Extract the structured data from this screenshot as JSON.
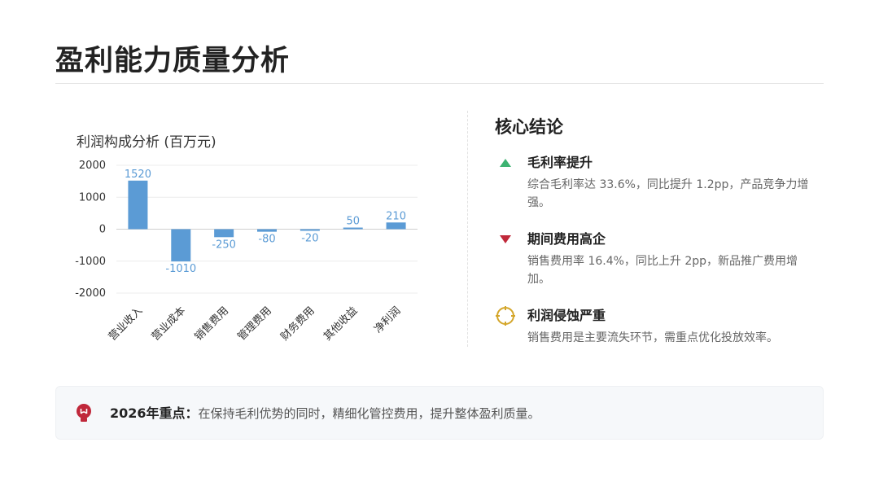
{
  "page": {
    "title": "盈利能力质量分析"
  },
  "chart_data": {
    "type": "bar",
    "title": "利润构成分析 (百万元)",
    "categories": [
      "营业收入",
      "营业成本",
      "销售费用",
      "管理费用",
      "财务费用",
      "其他收益",
      "净利润"
    ],
    "values": [
      1520,
      -1010,
      -250,
      -80,
      -20,
      50,
      210
    ],
    "value_labels": [
      "1520",
      "-1010",
      "-250",
      "-80",
      "-20",
      "50",
      "210"
    ],
    "ylim": [
      -2000,
      2000
    ],
    "yticks": [
      2000,
      1000,
      0,
      -1000,
      -2000
    ],
    "ytick_labels": [
      "2000",
      "1000",
      "0",
      "-1000",
      "-2000"
    ],
    "grid": true,
    "bar_color": "#5b9bd5",
    "label_color": "#5b9bd5"
  },
  "conclusions": {
    "title": "核心结论",
    "items": [
      {
        "icon": "triangle-up-icon",
        "icon_color": "#3cb371",
        "title": "毛利率提升",
        "desc": "综合毛利率达 33.6%，同比提升 1.2pp，产品竞争力增强。"
      },
      {
        "icon": "triangle-down-icon",
        "icon_color": "#c0283a",
        "title": "期间费用高企",
        "desc": "销售费用率 16.4%，同比上升 2pp，新品推广费用增加。"
      },
      {
        "icon": "target-icon",
        "icon_color": "#d4a62a",
        "title": "利润侵蚀严重",
        "desc": "销售费用是主要流失环节，需重点优化投放效率。"
      }
    ]
  },
  "focus": {
    "icon": "lightbulb-icon",
    "icon_color": "#c0283a",
    "label": "2026年重点：",
    "text": "在保持毛利优势的同时，精细化管控费用，提升整体盈利质量。"
  }
}
